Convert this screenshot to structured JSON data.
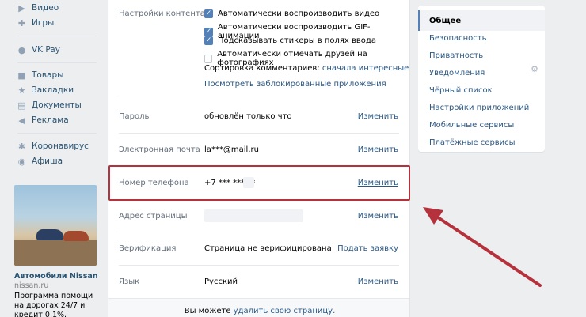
{
  "sidebar": {
    "items_top": [
      {
        "label": "Видео",
        "icon": "video-icon"
      },
      {
        "label": "Игры",
        "icon": "games-icon"
      }
    ],
    "vkpay": {
      "label": "VK Pay",
      "icon": "vkpay-icon"
    },
    "items_mid": [
      {
        "label": "Товары",
        "icon": "goods-icon"
      },
      {
        "label": "Закладки",
        "icon": "bookmark-icon"
      },
      {
        "label": "Документы",
        "icon": "document-icon"
      },
      {
        "label": "Реклама",
        "icon": "ads-icon"
      }
    ],
    "items_bottom": [
      {
        "label": "Коронавирус",
        "icon": "virus-icon"
      },
      {
        "label": "Афиша",
        "icon": "poster-icon"
      }
    ],
    "ad": {
      "title": "Автомобили Nissan",
      "domain": "nissan.ru",
      "text": "Программа помощи на дорогах 24/7 и кредит 0,1%. nissan.ru"
    }
  },
  "settings": {
    "content": {
      "label": "Настройки контента",
      "checkboxes": [
        {
          "label": "Автоматически воспроизводить видео",
          "checked": true
        },
        {
          "label": "Автоматически воспроизводить GIF-анимации",
          "checked": true
        },
        {
          "label": "Подсказывать стикеры в полях ввода",
          "checked": true
        },
        {
          "label": "Автоматически отмечать друзей на фотографиях",
          "checked": false
        }
      ],
      "sort_label": "Сортировка комментариев:",
      "sort_value": "сначала интересные",
      "blocked_apps": "Посмотреть заблокированные приложения"
    },
    "password": {
      "label": "Пароль",
      "value": "обновлён только что",
      "action": "Изменить"
    },
    "email": {
      "label": "Электронная почта",
      "value": "la***@mail.ru",
      "action": "Изменить"
    },
    "phone": {
      "label": "Номер телефона",
      "value": "+7 *** *** **",
      "action": "Изменить"
    },
    "address": {
      "label": "Адрес страницы",
      "value": "",
      "action": "Изменить"
    },
    "verification": {
      "label": "Верификация",
      "value": "Страница не верифицирована",
      "action": "Подать заявку"
    },
    "language": {
      "label": "Язык",
      "value": "Русский",
      "action": "Изменить"
    },
    "footer": {
      "prefix": "Вы можете",
      "link": "удалить свою страницу."
    }
  },
  "menu": {
    "items": [
      {
        "label": "Общее",
        "active": true
      },
      {
        "label": "Безопасность"
      },
      {
        "label": "Приватность"
      },
      {
        "label": "Уведомления"
      },
      {
        "label": "Чёрный список"
      },
      {
        "label": "Настройки приложений"
      },
      {
        "label": "Мобильные сервисы"
      },
      {
        "label": "Платёжные сервисы"
      }
    ]
  },
  "colors": {
    "accent": "#5181b8",
    "link": "#2a5885",
    "highlight": "#b5313c",
    "background": "#edeef0"
  }
}
